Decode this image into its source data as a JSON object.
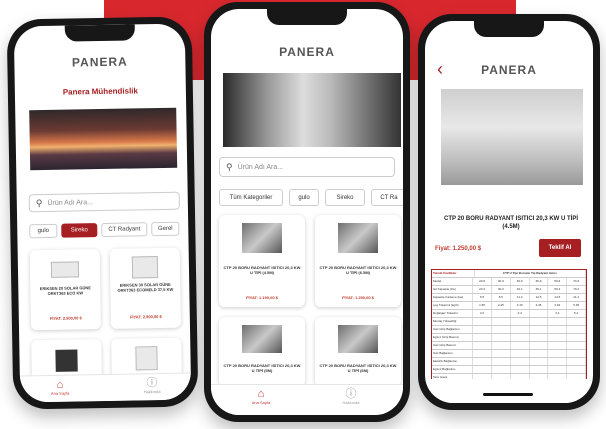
{
  "brand": {
    "logo": "PANERA",
    "accent": "#a51f23",
    "bg_red": "#d8282e"
  },
  "phone_left": {
    "title": "Panera Mühendislik",
    "search_placeholder": "Ürün Adı Ara...",
    "chips": [
      "gulo",
      "Sireko",
      "CT Radyant",
      "Gerel"
    ],
    "cards": [
      {
        "name": "ERIKSEN 20 SOLAR GÜNE ORKT363 ECO KW",
        "price": "FİYAT: 2.500,00 $"
      },
      {
        "name": "ERIKSEN 30 SOLAR GÜNE ORKT363 ECOMELD 37,5 KW",
        "price": "FİYAT: 2.900,00 $"
      },
      {
        "name": "",
        "price": ""
      },
      {
        "name": "",
        "price": ""
      }
    ],
    "tabs": [
      "Ana Sayfa",
      "Hakkında"
    ]
  },
  "phone_center": {
    "search_placeholder": "Ürün Adı Ara...",
    "chips": [
      "Tüm Kategoriler",
      "gulo",
      "Sireko",
      "CT Ra"
    ],
    "cards": [
      {
        "name": "CTP 20 BORU RADYANT ISITICI 20,3 KW U TİPİ (4.5M)",
        "price": "FİYAT: 1.190,00 $"
      },
      {
        "name": "CTP 20 BORU RADYANT ISITICI 20,3 KW U TİPİ (6.5M)",
        "price": "FİYAT: 1.250,00 $"
      },
      {
        "name": "CTP 20 BORU RADYANT ISITICI 20,3 KW U TİPİ (5M)",
        "price": ""
      },
      {
        "name": "CTP 20 BORU RADYANT ISITICI 20,3 KW U TİPİ (6M)",
        "price": ""
      }
    ],
    "tabs": [
      "Ana Sayfa",
      "Hakkında"
    ]
  },
  "phone_right": {
    "back": "‹",
    "product_title": "CTP 20 BORU RADYANT ISITICI 20,3 KW U TİPİ (4.5M)",
    "price": "Fiyat: 1.250,00 $",
    "offer_button": "Teklif Al",
    "table_title": "Teknik Özellikler",
    "table_subtitle": "CTP U Tipi Boruslu Tip Radyant Isıtıcı",
    "table_rows": [
      [
        "Model",
        "20-6",
        "30-9",
        "40-6",
        "45-6",
        "50-6",
        "70-6"
      ],
      [
        "Isıl Kapasite (kw)",
        "20.3",
        "30.3",
        "40.1",
        "45.1",
        "50.3",
        "70.2"
      ],
      [
        "Kapasite Kademe (kw)",
        "5.5",
        "8.5",
        "11.2",
        "12.5",
        "14.5",
        "21.2"
      ],
      [
        "Lpg Tüketimi (kg/h)",
        "1.55",
        "2.25",
        "3.15",
        "3.45",
        "3.92",
        "5.35"
      ],
      [
        "Doğalgaz Tüketimi",
        "2.0",
        "",
        "3.4",
        "",
        "3.4",
        "5.4"
      ],
      [
        "Montaj Yüksekliği",
        "",
        "",
        "",
        "",
        "",
        ""
      ],
      [
        "Gaz Giriş Bağlantısı",
        "",
        "",
        "",
        "",
        "",
        ""
      ],
      [
        "Egzoz Giriş Basıncı",
        "",
        "",
        "",
        "",
        "",
        ""
      ],
      [
        "Gaz Giriş Basıncı",
        "",
        "",
        "",
        "",
        "",
        ""
      ],
      [
        "Gaz Bağlantısı",
        "",
        "",
        "",
        "",
        "",
        ""
      ],
      [
        "Elektrik Bağlantısı",
        "",
        "",
        "",
        "",
        "",
        ""
      ],
      [
        "Egzoz Bağlantısı",
        "",
        "",
        "",
        "",
        "",
        ""
      ],
      [
        "Taze Hava",
        "",
        "",
        "",
        "",
        "",
        ""
      ]
    ]
  }
}
